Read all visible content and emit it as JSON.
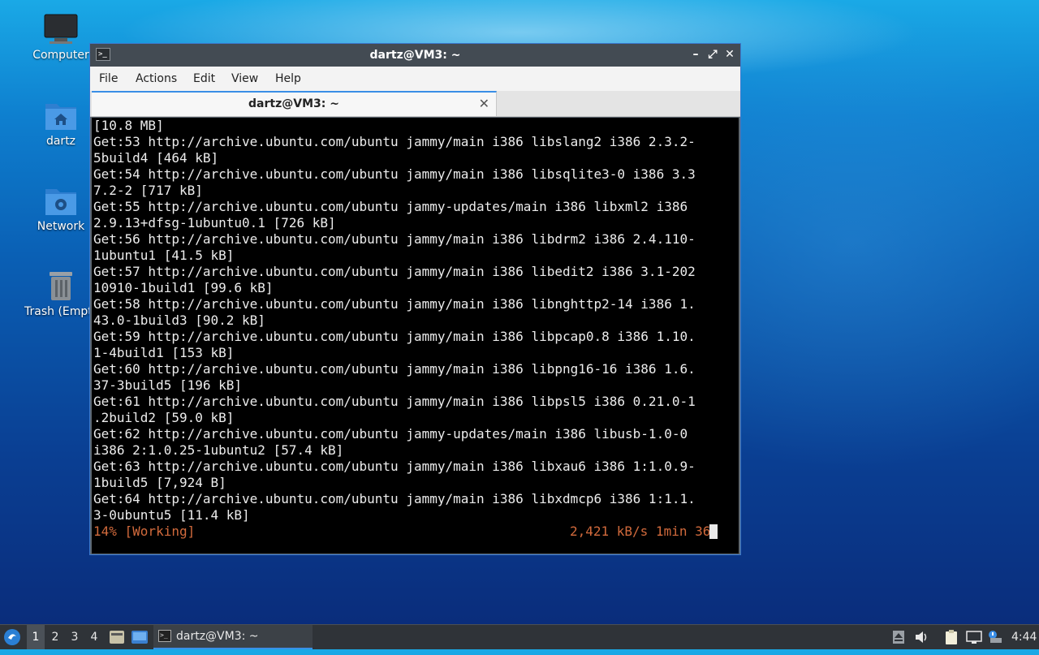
{
  "desktop": {
    "icons": [
      {
        "label": "Computer",
        "icon": "monitor-icon"
      },
      {
        "label": "dartz",
        "icon": "home-folder-icon"
      },
      {
        "label": "Network",
        "icon": "network-folder-icon"
      },
      {
        "label": "Trash (Empty)",
        "icon": "trash-icon"
      }
    ]
  },
  "window": {
    "title": "dartz@VM3: ~",
    "controls": {
      "minimize": "–",
      "maximize": "⤢",
      "close": "✕"
    },
    "menu": [
      "File",
      "Actions",
      "Edit",
      "View",
      "Help"
    ],
    "tab": {
      "title": "dartz@VM3: ~",
      "close": "✕"
    }
  },
  "terminal": {
    "lines": [
      "[10.8 MB]",
      "Get:53 http://archive.ubuntu.com/ubuntu jammy/main i386 libslang2 i386 2.3.2-",
      "5build4 [464 kB]",
      "Get:54 http://archive.ubuntu.com/ubuntu jammy/main i386 libsqlite3-0 i386 3.3",
      "7.2-2 [717 kB]",
      "Get:55 http://archive.ubuntu.com/ubuntu jammy-updates/main i386 libxml2 i386",
      "2.9.13+dfsg-1ubuntu0.1 [726 kB]",
      "Get:56 http://archive.ubuntu.com/ubuntu jammy/main i386 libdrm2 i386 2.4.110-",
      "1ubuntu1 [41.5 kB]",
      "Get:57 http://archive.ubuntu.com/ubuntu jammy/main i386 libedit2 i386 3.1-202",
      "10910-1build1 [99.6 kB]",
      "Get:58 http://archive.ubuntu.com/ubuntu jammy/main i386 libnghttp2-14 i386 1.",
      "43.0-1build3 [90.2 kB]",
      "Get:59 http://archive.ubuntu.com/ubuntu jammy/main i386 libpcap0.8 i386 1.10.",
      "1-4build1 [153 kB]",
      "Get:60 http://archive.ubuntu.com/ubuntu jammy/main i386 libpng16-16 i386 1.6.",
      "37-3build5 [196 kB]",
      "Get:61 http://archive.ubuntu.com/ubuntu jammy/main i386 libpsl5 i386 0.21.0-1",
      ".2build2 [59.0 kB]",
      "Get:62 http://archive.ubuntu.com/ubuntu jammy-updates/main i386 libusb-1.0-0",
      "i386 2:1.0.25-1ubuntu2 [57.4 kB]",
      "Get:63 http://archive.ubuntu.com/ubuntu jammy/main i386 libxau6 i386 1:1.0.9-",
      "1build5 [7,924 B]",
      "Get:64 http://archive.ubuntu.com/ubuntu jammy/main i386 libxdmcp6 i386 1:1.1.",
      "3-0ubuntu5 [11.4 kB]"
    ],
    "status_left": "14% [Working]",
    "status_right": "2,421 kB/s 1min 36s",
    "status_color": "#d26a3c"
  },
  "taskbar": {
    "workspaces": [
      "1",
      "2",
      "3",
      "4"
    ],
    "active_workspace": "1",
    "task_label": "dartz@VM3: ~",
    "clock": "4:44",
    "accent": "#3a8ee6"
  }
}
